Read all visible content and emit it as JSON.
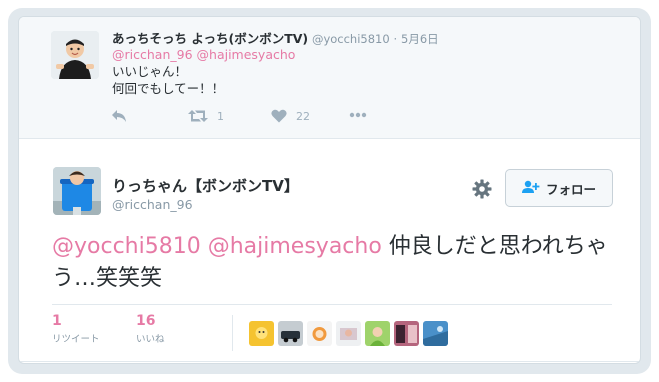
{
  "parent_tweet": {
    "display_name": "あっちそっち よっち(ボンボンTV)",
    "handle": "@yocchi5810",
    "separator": "·",
    "date": "5月6日",
    "mention_1": "@ricchan_96",
    "mention_2": "@hajimesyacho",
    "line_1": "いいじゃん！",
    "line_2": "何回でもしてー！！",
    "retweet_count": "1",
    "like_count": "22",
    "icons": [
      "reply-icon",
      "retweet-icon",
      "heart-icon",
      "more-icon"
    ]
  },
  "main_tweet": {
    "display_name": "りっちゃん【ボンボンTV】",
    "handle": "@ricchan_96",
    "follow_label": "フォロー",
    "mention_1": "@yocchi5810",
    "mention_2": "@hajimesyacho",
    "text_rest": " 仲良しだと思われちゃう…笑笑笑",
    "retweets": {
      "count": "1",
      "label": "リツイート"
    },
    "likes": {
      "count": "16",
      "label": "いいね"
    },
    "liker_avatars": 7
  },
  "colors": {
    "accent_mention": "#e67aa5",
    "muted": "#8899a6",
    "text": "#292f33",
    "frame": "#e1e8ed"
  }
}
